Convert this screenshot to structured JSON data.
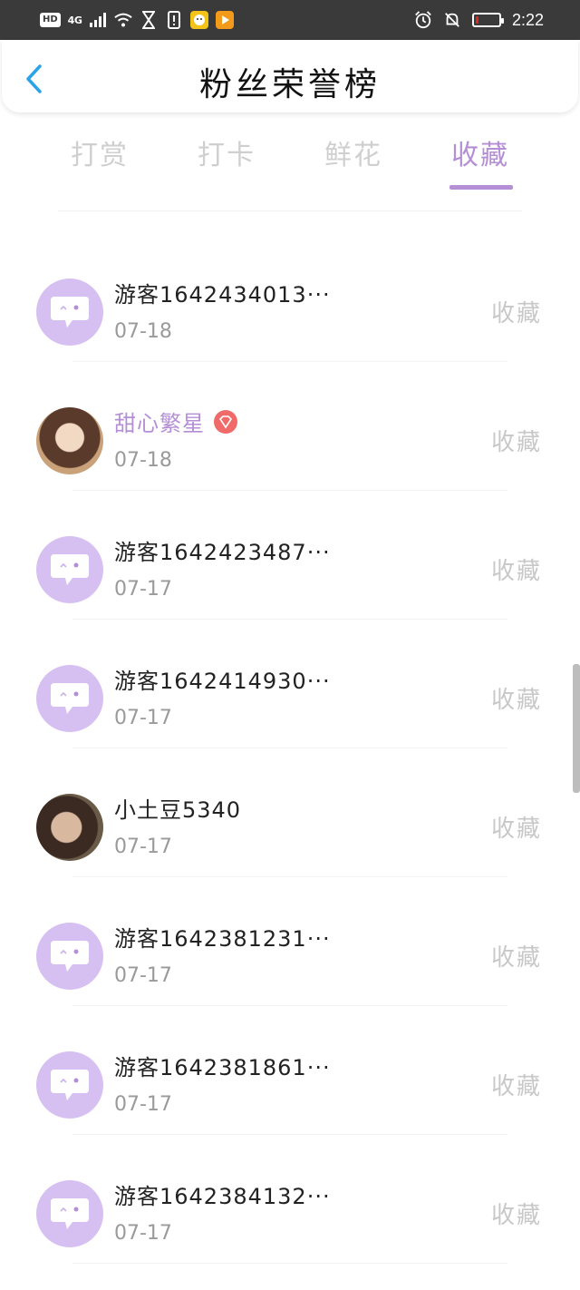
{
  "status_bar": {
    "hd": "HD",
    "signal": "4G",
    "time": "2:22",
    "battery_level": 0.1,
    "colors": {
      "background": "#3a3a3a",
      "battery": "#e0281f",
      "app1": "#f3c318",
      "app2": "#f39a1a"
    }
  },
  "header": {
    "title": "粉丝荣誉榜",
    "back_icon": "chevron-left-icon",
    "accent": "#2aa3e8"
  },
  "tabs": [
    {
      "label": "打赏",
      "active": false
    },
    {
      "label": "打卡",
      "active": false
    },
    {
      "label": "鲜花",
      "active": false
    },
    {
      "label": "收藏",
      "active": true
    }
  ],
  "accent_color": "#b48fd6",
  "fans": [
    {
      "name": "游客1642434013···",
      "date": "07-18",
      "action": "收藏",
      "avatar": "default-chat-avatar-icon",
      "vip": false
    },
    {
      "name": "甜心繁星",
      "date": "07-18",
      "action": "收藏",
      "avatar": "user-photo",
      "vip": true
    },
    {
      "name": "游客1642423487···",
      "date": "07-17",
      "action": "收藏",
      "avatar": "default-chat-avatar-icon",
      "vip": false
    },
    {
      "name": "游客1642414930···",
      "date": "07-17",
      "action": "收藏",
      "avatar": "default-chat-avatar-icon",
      "vip": false
    },
    {
      "name": "小土豆5340",
      "date": "07-17",
      "action": "收藏",
      "avatar": "user-photo",
      "vip": false
    },
    {
      "name": "游客1642381231···",
      "date": "07-17",
      "action": "收藏",
      "avatar": "default-chat-avatar-icon",
      "vip": false
    },
    {
      "name": "游客1642381861···",
      "date": "07-17",
      "action": "收藏",
      "avatar": "default-chat-avatar-icon",
      "vip": false
    },
    {
      "name": "游客1642384132···",
      "date": "07-17",
      "action": "收藏",
      "avatar": "default-chat-avatar-icon",
      "vip": false
    }
  ]
}
